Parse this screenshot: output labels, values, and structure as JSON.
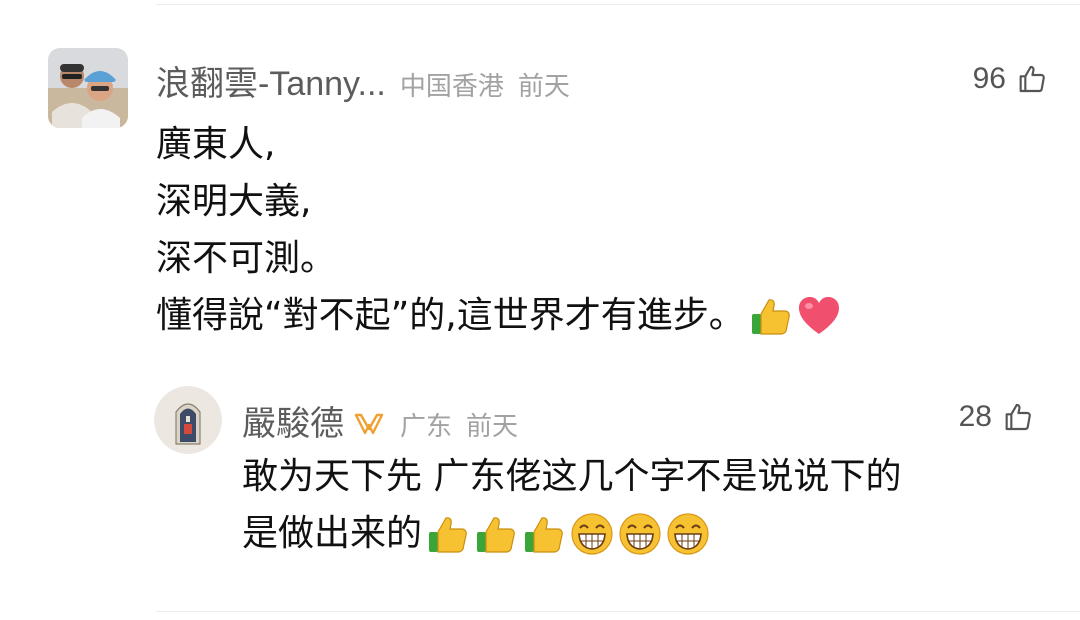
{
  "comments": [
    {
      "username": "浪翻雲-Tanny...",
      "location": "中国香港",
      "time": "前天",
      "likes": "96",
      "lines": [
        "廣東人,",
        "深明大義,",
        "深不可測。",
        "懂得說“對不起”的,這世界才有進步。"
      ],
      "trailing_emojis": [
        "thumbs-up-emoji",
        "heart-emoji"
      ]
    },
    {
      "username": "嚴駿德",
      "location": "广东",
      "time": "前天",
      "likes": "28",
      "badge": "vip-badge-icon",
      "lines": [
        "敢为天下先 广东佬这几个字不是说说下的",
        "是做出来的"
      ],
      "trailing_emojis": [
        "thumbs-up-emoji",
        "thumbs-up-emoji",
        "thumbs-up-emoji",
        "grin-emoji",
        "grin-emoji",
        "grin-emoji"
      ]
    }
  ],
  "colors": {
    "username": "#5c5c5c",
    "meta": "#a2a2a2",
    "text": "#111111",
    "vip_badge": "#f0a030",
    "divider": "#ececec"
  }
}
